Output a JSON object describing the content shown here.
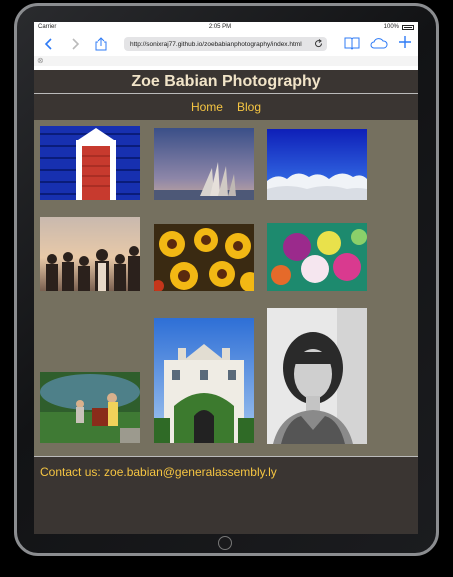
{
  "status": {
    "carrier": "Carrier",
    "time": "2:05 PM",
    "battery": "100%"
  },
  "browser": {
    "url": "http://sonixraj77.github.io/zoebabianphotography/index.html",
    "tab_close": "⊗"
  },
  "site": {
    "title": "Zoe Babian Photography",
    "nav": [
      {
        "label": "Home"
      },
      {
        "label": "Blog"
      }
    ],
    "footer": "Contact us: zoe.babian@generalassembly.ly"
  },
  "colors": {
    "page_bg": "#75705f",
    "header_bg": "#3a3532",
    "title": "#f1e4c8",
    "link": "#f5c542"
  }
}
